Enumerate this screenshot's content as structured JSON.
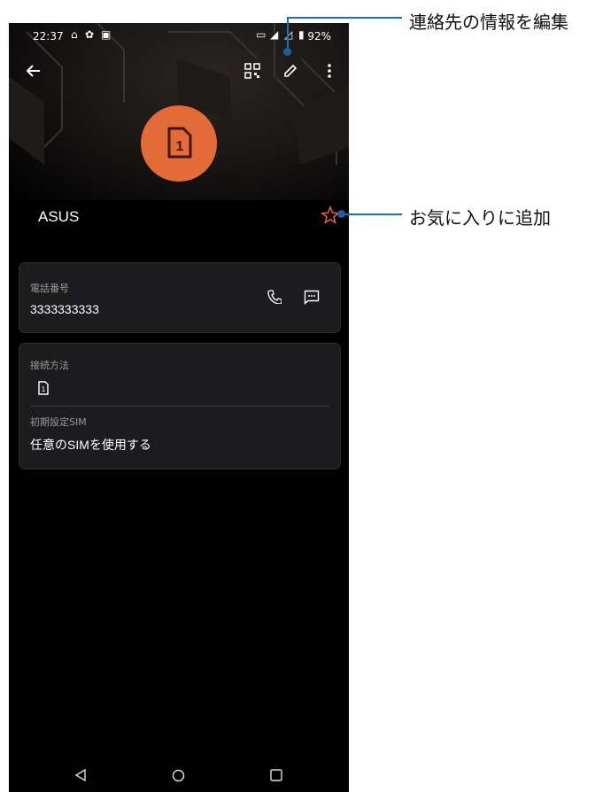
{
  "status_bar": {
    "time": "22:37",
    "battery": "92%"
  },
  "contact": {
    "name": "ASUS",
    "avatar_text": "1"
  },
  "phone_card": {
    "label": "電話番号",
    "value": "3333333333"
  },
  "connection_card": {
    "label": "接続方法",
    "sim_badge": "1",
    "default_sim_label": "初期設定SIM",
    "default_sim_value": "任意のSIMを使用する"
  },
  "annotations": {
    "edit": "連絡先の情報を編集",
    "favorite": "お気に入りに追加"
  },
  "colors": {
    "accent": "#e46a38",
    "callout": "#1a6fb5"
  }
}
